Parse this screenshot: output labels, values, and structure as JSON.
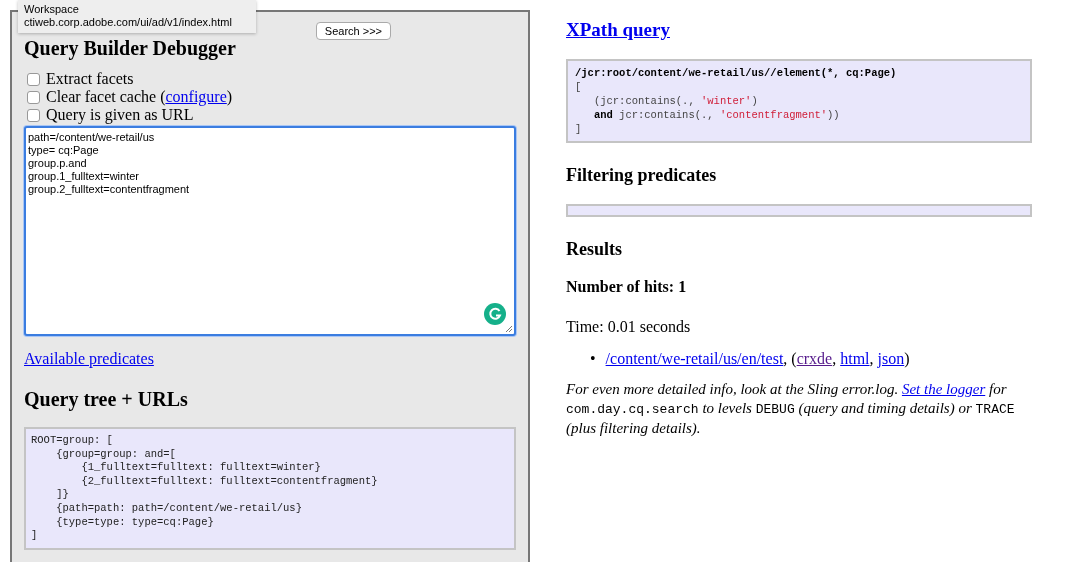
{
  "tooltip": {
    "title": "Workspace",
    "url": "ctiweb.corp.adobe.com/ui/ad/v1/index.html"
  },
  "debugger": {
    "title": "Query Builder Debugger",
    "search_button": "Search >>>",
    "options": [
      {
        "label": "Extract facets",
        "checked": false
      },
      {
        "label": "Clear facet cache (",
        "link": "configure",
        "after": ")",
        "checked": false
      },
      {
        "label": "Query is given as URL",
        "checked": false
      }
    ],
    "query": "path=/content/we-retail/us\ntype= cq:Page\ngroup.p.and\ngroup.1_fulltext=winter\ngroup.2_fulltext=contentfragment",
    "predicates_link": "Available predicates",
    "tree_title": "Query tree + URLs",
    "tree": "ROOT=group: [\n    {group=group: and=[\n        {1_fulltext=fulltext: fulltext=winter}\n        {2_fulltext=fulltext: fulltext=contentfragment}\n    ]}\n    {path=path: path=/content/we-retail/us}\n    {type=type: type=cq:Page}\n]"
  },
  "xpath": {
    "title": "XPath query",
    "lines": [
      {
        "indent": false,
        "segs": [
          {
            "kind": "bold",
            "text": "/jcr:root/content/we-retail/us//element(*, cq:Page)"
          }
        ]
      },
      {
        "indent": false,
        "segs": [
          {
            "kind": "plain",
            "text": "["
          }
        ]
      },
      {
        "indent": true,
        "segs": [
          {
            "kind": "plain",
            "text": "(jcr:contains(., "
          },
          {
            "kind": "string",
            "text": "'winter'"
          },
          {
            "kind": "plain",
            "text": ")"
          }
        ]
      },
      {
        "indent": true,
        "segs": [
          {
            "kind": "bold",
            "text": "and"
          },
          {
            "kind": "plain",
            "text": " jcr:contains(., "
          },
          {
            "kind": "string",
            "text": "'contentfragment'"
          },
          {
            "kind": "plain",
            "text": "))"
          }
        ]
      },
      {
        "indent": false,
        "segs": [
          {
            "kind": "plain",
            "text": "]"
          }
        ]
      }
    ]
  },
  "filtering": {
    "title": "Filtering predicates"
  },
  "results": {
    "title": "Results",
    "hits": "Number of hits: 1",
    "time": "Time: 0.01 seconds",
    "items": [
      {
        "bullet": "•",
        "path": "/content/we-retail/us/en/test",
        "sep": ", (",
        "links": [
          {
            "label": "crxde",
            "visited": true
          },
          {
            "prefix": ", ",
            "label": "html",
            "visited": false
          },
          {
            "prefix": ", ",
            "label": "json",
            "visited": false
          }
        ],
        "close": ")"
      }
    ],
    "note": [
      {
        "kind": "text",
        "text": "For even more detailed info, look at the Sling error.log. "
      },
      {
        "kind": "link",
        "text": "Set the logger"
      },
      {
        "kind": "text",
        "text": " for "
      },
      {
        "kind": "code",
        "text": "com.day.cq.search"
      },
      {
        "kind": "text",
        "text": " to levels "
      },
      {
        "kind": "code",
        "text": "DEBUG"
      },
      {
        "kind": "text",
        "text": " (query and timing details) or "
      },
      {
        "kind": "code",
        "text": "TRACE"
      },
      {
        "kind": "text",
        "text": " (plus filtering details)."
      }
    ]
  }
}
